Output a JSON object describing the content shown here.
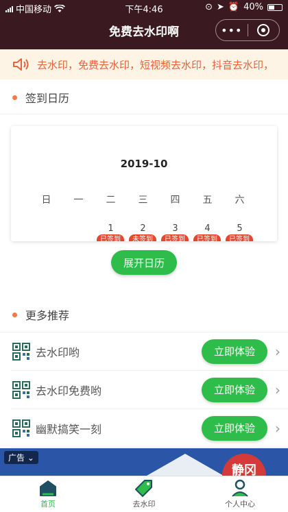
{
  "status_bar": {
    "carrier": "中国移动",
    "time": "下午4:46",
    "battery": "40%"
  },
  "nav": {
    "title": "免费去水印啊",
    "more_glyph": "•••"
  },
  "notice": {
    "text": "去水印，免费去水印，短视频去水印，抖音去水印，"
  },
  "calendar_section": {
    "title": "签到日历",
    "month": "2019-10",
    "weekdays": [
      "日",
      "一",
      "二",
      "三",
      "四",
      "五",
      "六"
    ],
    "days": [
      {
        "num": "1",
        "status": "已签到"
      },
      {
        "num": "2",
        "status": "未签到"
      },
      {
        "num": "3",
        "status": "已签到"
      },
      {
        "num": "4",
        "status": "已签到"
      },
      {
        "num": "5",
        "status": "已签到"
      }
    ],
    "expand_label": "展开日历"
  },
  "recommend_section": {
    "title": "更多推荐",
    "items": [
      {
        "name": "去水印哟",
        "button": "立即体验"
      },
      {
        "name": "去水印免费哟",
        "button": "立即体验"
      },
      {
        "name": "幽默搞笑一刻",
        "button": "立即体验"
      }
    ]
  },
  "ad": {
    "label": "广告",
    "badge": "静冈"
  },
  "tabbar": {
    "tabs": [
      {
        "label": "首页",
        "icon": "home-icon",
        "active": true
      },
      {
        "label": "去水印",
        "icon": "tag-icon",
        "active": false
      },
      {
        "label": "个人中心",
        "icon": "user-icon",
        "active": false
      }
    ]
  },
  "colors": {
    "nav_bg": "#3a1a20",
    "accent_green": "#2ebd4a",
    "notice_text": "#e8623a",
    "sign_tag": "#e4472f",
    "section_dot": "#ef7c45"
  }
}
